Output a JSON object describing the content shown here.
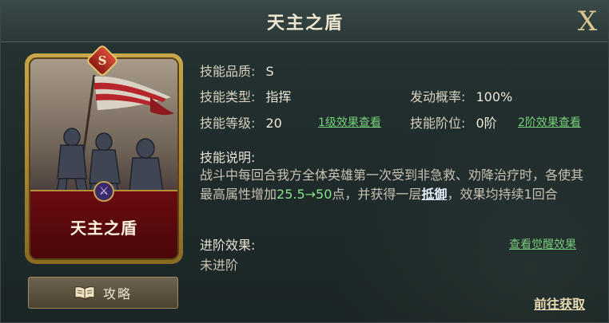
{
  "title": "天主之盾",
  "close_label": "X",
  "card": {
    "grade_badge": "S",
    "name": "天主之盾",
    "emblem_icon": "sword-emblem-icon"
  },
  "guide_button": {
    "label": "攻略",
    "icon": "book-icon"
  },
  "fields": {
    "quality_label": "技能品质:",
    "quality_value": "S",
    "type_label": "技能类型:",
    "type_value": "指挥",
    "rate_label": "发动概率:",
    "rate_value": "100%",
    "level_label": "技能等级:",
    "level_value": "20",
    "level_link": "1级效果查看",
    "rank_label": "技能阶位:",
    "rank_value": "0阶",
    "rank_link": "2阶效果查看"
  },
  "description": {
    "label": "技能说明:",
    "part1": "战斗中每回合我方全体英雄第一次受到非急救、劝降治疗时，各使其最高属性增加",
    "value_from": "25.5",
    "arrow": "→",
    "value_to": "50",
    "part2": "点，并获得一层",
    "keyword": "抵御",
    "part3": "，效果均持续1回合"
  },
  "advance": {
    "label": "进阶效果:",
    "link": "查看觉醒效果",
    "value": "未进阶"
  },
  "goto_label": "前往获取",
  "colors": {
    "accent_green": "#77d07a",
    "gold": "#c9a64a",
    "ribbon_red": "#6a0c10"
  }
}
